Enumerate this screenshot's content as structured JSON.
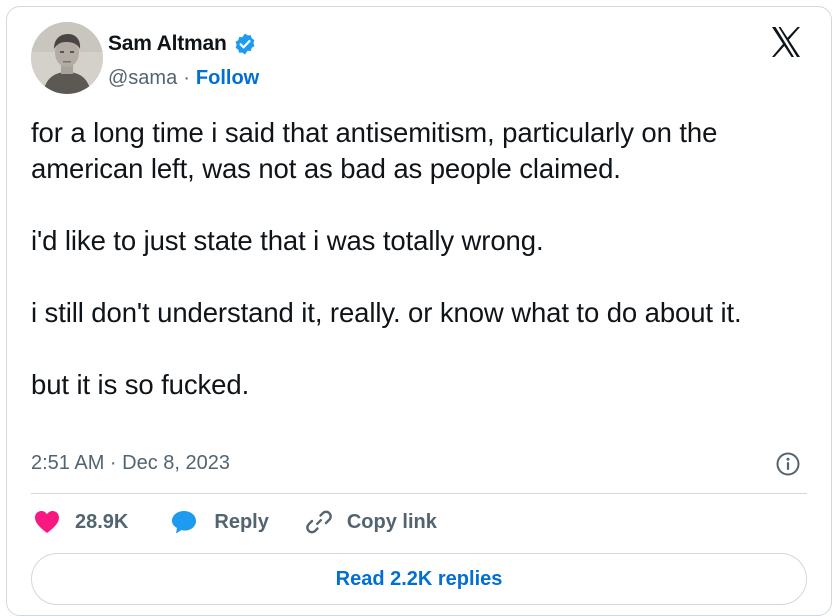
{
  "author": {
    "name": "Sam Altman",
    "handle": "@sama",
    "separator": "·",
    "follow_label": "Follow"
  },
  "icons": {
    "verified": "verified-badge-icon",
    "brand": "x-logo-icon",
    "info": "info-icon",
    "like": "heart-icon",
    "reply": "speech-bubble-icon",
    "copy": "link-icon"
  },
  "tweet": {
    "text": "for a long time i said that antisemitism, particularly on the american left, was not as bad as people claimed.\n\ni'd like to just state that i was totally wrong.\n\ni still don't understand it, really. or know what to do about it.\n\nbut it is so fucked.",
    "timestamp": "2:51 AM · Dec 8, 2023"
  },
  "actions": {
    "like_count": "28.9K",
    "reply_label": "Reply",
    "copy_label": "Copy link"
  },
  "replies": {
    "label": "Read 2.2K replies"
  },
  "colors": {
    "like": "#f91880",
    "reply": "#1d9bf0",
    "link": "#006fd6",
    "muted": "#536471",
    "border": "#cfd9de"
  }
}
